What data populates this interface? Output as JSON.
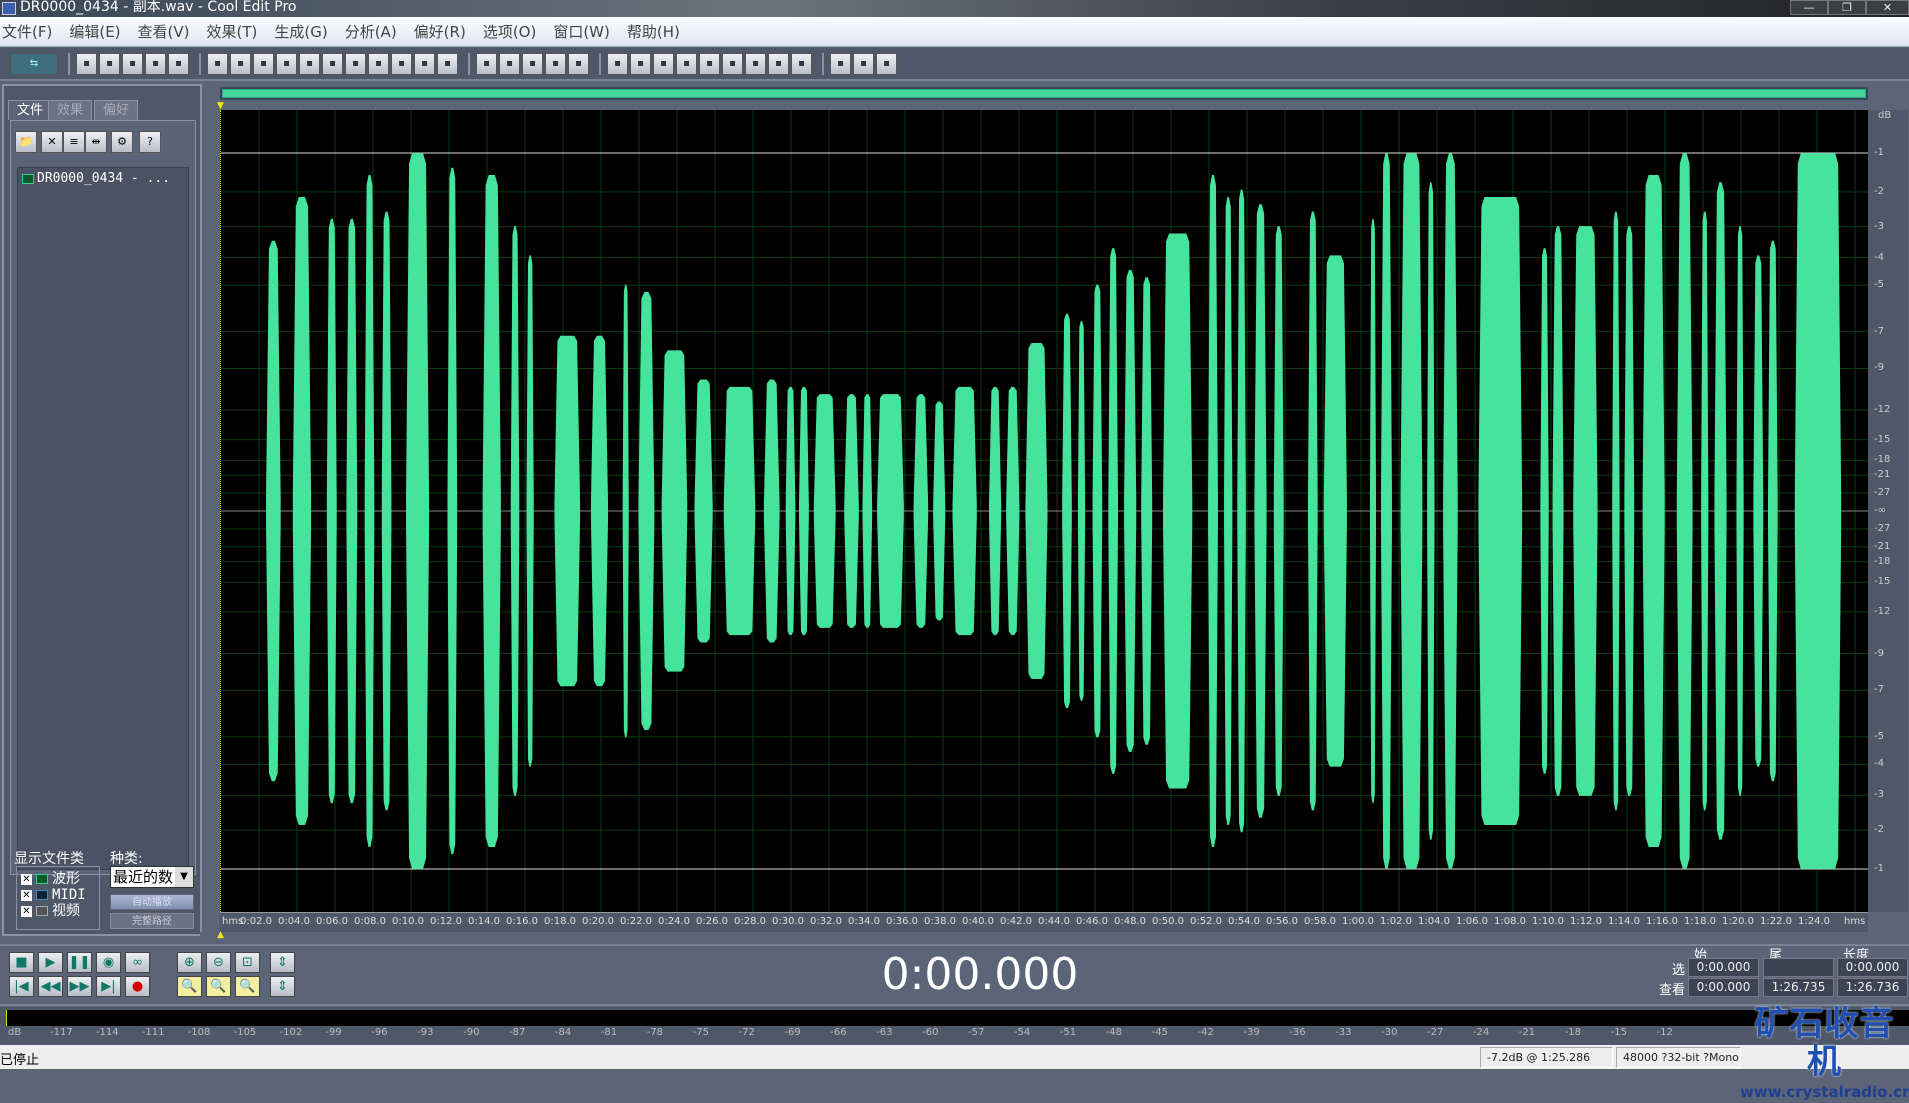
{
  "window": {
    "title": "DR0000_0434 - 副本.wav - Cool Edit Pro",
    "minimize": "—",
    "maximize": "❐",
    "close": "✕"
  },
  "menu": [
    "文件(F)",
    "编辑(E)",
    "查看(V)",
    "效果(T)",
    "生成(G)",
    "分析(A)",
    "偏好(R)",
    "选项(O)",
    "窗口(W)",
    "帮助(H)"
  ],
  "toolbar": {
    "groups": [
      [
        "multitrack-toggle"
      ],
      [
        "new-file",
        "open-file",
        "close-file",
        "save-file",
        "save-all"
      ],
      [
        "undo",
        "redo",
        "repeat",
        "copy-to-new",
        "copy",
        "cut",
        "paste",
        "paste-new",
        "mix-paste",
        "trim",
        "snap"
      ],
      [
        "spectral-view",
        "waveform-view",
        "cue-list",
        "play-list",
        "marker-list"
      ],
      [
        "show-frequency",
        "show-info",
        "show-status",
        "transport",
        "zoom",
        "time",
        "levels",
        "meter",
        "blank"
      ],
      [
        "settings",
        "scripts",
        "help"
      ]
    ]
  },
  "left_panel": {
    "tabs": [
      "文件",
      "效果",
      "偏好"
    ],
    "tool_icons": [
      "open-folder",
      "close-file",
      "insert-multitrack",
      "insert-playlist",
      "options",
      "help"
    ],
    "files": [
      "DR0000_0434 - ..."
    ],
    "show_types_label": "显示文件类",
    "types": [
      {
        "label": "波形",
        "checked": true
      },
      {
        "label": "MIDI",
        "checked": true
      },
      {
        "label": "视频",
        "checked": true
      }
    ],
    "sort_label": "种类:",
    "sort_value": "最近的数",
    "auto_play": "自动播放",
    "full_path": "完整路径"
  },
  "waveform": {
    "color": "#46e39c",
    "duration_s": 86.736,
    "bursts": [
      [
        2.37,
        3.14,
        0.37
      ],
      [
        3.78,
        4.74,
        0.43
      ],
      [
        5.57,
        6.09,
        0.4
      ],
      [
        6.6,
        7.17,
        0.4
      ],
      [
        7.56,
        8.07,
        0.46
      ],
      [
        8.46,
        8.97,
        0.41
      ],
      [
        9.74,
        10.95,
        0.49
      ],
      [
        11.92,
        12.43,
        0.47
      ],
      [
        13.77,
        14.73,
        0.46
      ],
      [
        15.25,
        15.7,
        0.39
      ],
      [
        16.08,
        16.46,
        0.35
      ],
      [
        17.55,
        18.9,
        0.24
      ],
      [
        19.47,
        20.37,
        0.24
      ],
      [
        21.14,
        21.46,
        0.31
      ],
      [
        21.97,
        22.81,
        0.3
      ],
      [
        23.19,
        24.54,
        0.22
      ],
      [
        24.92,
        25.88,
        0.18
      ],
      [
        26.46,
        28.12,
        0.17
      ],
      [
        28.57,
        29.4,
        0.18
      ],
      [
        29.72,
        30.23,
        0.17
      ],
      [
        30.42,
        30.94,
        0.17
      ],
      [
        31.2,
        32.35,
        0.16
      ],
      [
        32.8,
        33.57,
        0.16
      ],
      [
        33.76,
        34.27,
        0.16
      ],
      [
        34.53,
        35.94,
        0.16
      ],
      [
        36.45,
        37.22,
        0.16
      ],
      [
        37.48,
        38.12,
        0.15
      ],
      [
        38.5,
        39.78,
        0.17
      ],
      [
        40.42,
        41.06,
        0.17
      ],
      [
        41.32,
        42.02,
        0.17
      ],
      [
        42.34,
        43.5,
        0.23
      ],
      [
        44.27,
        44.78,
        0.27
      ],
      [
        45.1,
        45.48,
        0.26
      ],
      [
        45.87,
        46.38,
        0.31
      ],
      [
        46.7,
        47.21,
        0.36
      ],
      [
        47.53,
        48.17,
        0.33
      ],
      [
        48.43,
        49.01,
        0.32
      ],
      [
        49.58,
        51.12,
        0.38
      ],
      [
        51.95,
        52.47,
        0.46
      ],
      [
        52.79,
        53.23,
        0.43
      ],
      [
        53.49,
        53.94,
        0.44
      ],
      [
        54.39,
        55.03,
        0.42
      ],
      [
        55.41,
        55.93,
        0.39
      ],
      [
        57.21,
        57.72,
        0.41
      ],
      [
        58.04,
        59.26,
        0.35
      ],
      [
        60.47,
        60.79,
        0.4
      ],
      [
        61.05,
        61.63,
        0.49
      ],
      [
        62.08,
        63.23,
        0.49
      ],
      [
        63.48,
        63.87,
        0.45
      ],
      [
        64.32,
        65.09,
        0.49
      ],
      [
        66.18,
        68.48,
        0.43
      ],
      [
        69.44,
        69.88,
        0.36
      ],
      [
        70.08,
        70.66,
        0.39
      ],
      [
        71.17,
        72.45,
        0.39
      ],
      [
        73.22,
        73.61,
        0.41
      ],
      [
        73.86,
        74.38,
        0.39
      ],
      [
        74.82,
        75.98,
        0.46
      ],
      [
        76.62,
        77.45,
        0.49
      ],
      [
        77.9,
        78.28,
        0.41
      ],
      [
        78.6,
        79.24,
        0.45
      ],
      [
        79.76,
        80.14,
        0.39
      ],
      [
        80.65,
        81.17,
        0.35
      ],
      [
        81.42,
        81.93,
        0.37
      ],
      [
        82.83,
        85.27,
        0.49
      ]
    ]
  },
  "db_scale": {
    "unit": "dB",
    "labels": [
      "-1",
      "-2",
      "-3",
      "-4",
      "-5",
      "-7",
      "-9",
      "-12",
      "-15",
      "-18",
      "-21",
      "-27",
      "-∞",
      "-27",
      "-21",
      "-18",
      "-15",
      "-12",
      "-9",
      "-7",
      "-5",
      "-4",
      "-3",
      "-2",
      "-1"
    ]
  },
  "time_ruler": {
    "unit": "hms",
    "labels": [
      "0:02.0",
      "0:04.0",
      "0:06.0",
      "0:08.0",
      "0:10.0",
      "0:12.0",
      "0:14.0",
      "0:16.0",
      "0:18.0",
      "0:20.0",
      "0:22.0",
      "0:24.0",
      "0:26.0",
      "0:28.0",
      "0:30.0",
      "0:32.0",
      "0:34.0",
      "0:36.0",
      "0:38.0",
      "0:40.0",
      "0:42.0",
      "0:44.0",
      "0:46.0",
      "0:48.0",
      "0:50.0",
      "0:52.0",
      "0:54.0",
      "0:56.0",
      "0:58.0",
      "1:00.0",
      "1:02.0",
      "1:04.0",
      "1:06.0",
      "1:08.0",
      "1:10.0",
      "1:12.0",
      "1:14.0",
      "1:16.0",
      "1:18.0",
      "1:20.0",
      "1:22.0",
      "1:24.0"
    ]
  },
  "transport": {
    "time": "0:00.000"
  },
  "selection": {
    "headers": [
      "始",
      "尾",
      "长度"
    ],
    "rows": [
      {
        "label": "选",
        "begin": "0:00.000",
        "end": "",
        "length": "0:00.000"
      },
      {
        "label": "查看",
        "begin": "0:00.000",
        "end": "1:26.735",
        "length": "1:26.736"
      }
    ]
  },
  "level_meter": {
    "unit": "dB",
    "labels": [
      "-117",
      "-114",
      "-111",
      "-108",
      "-105",
      "-102",
      "-99",
      "-96",
      "-93",
      "-90",
      "-87",
      "-84",
      "-81",
      "-78",
      "-75",
      "-72",
      "-69",
      "-66",
      "-63",
      "-60",
      "-57",
      "-54",
      "-51",
      "-48",
      "-45",
      "-42",
      "-39",
      "-36",
      "-33",
      "-30",
      "-27",
      "-24",
      "-21",
      "-18",
      "-15",
      "-12"
    ]
  },
  "status": {
    "state": "已停止",
    "cursor": "-7.2dB @  1:25.286",
    "format": "48000 ?32-bit ?Mono"
  },
  "watermark": {
    "name": "矿石收音机",
    "url": "www.crystalradio.cn"
  }
}
